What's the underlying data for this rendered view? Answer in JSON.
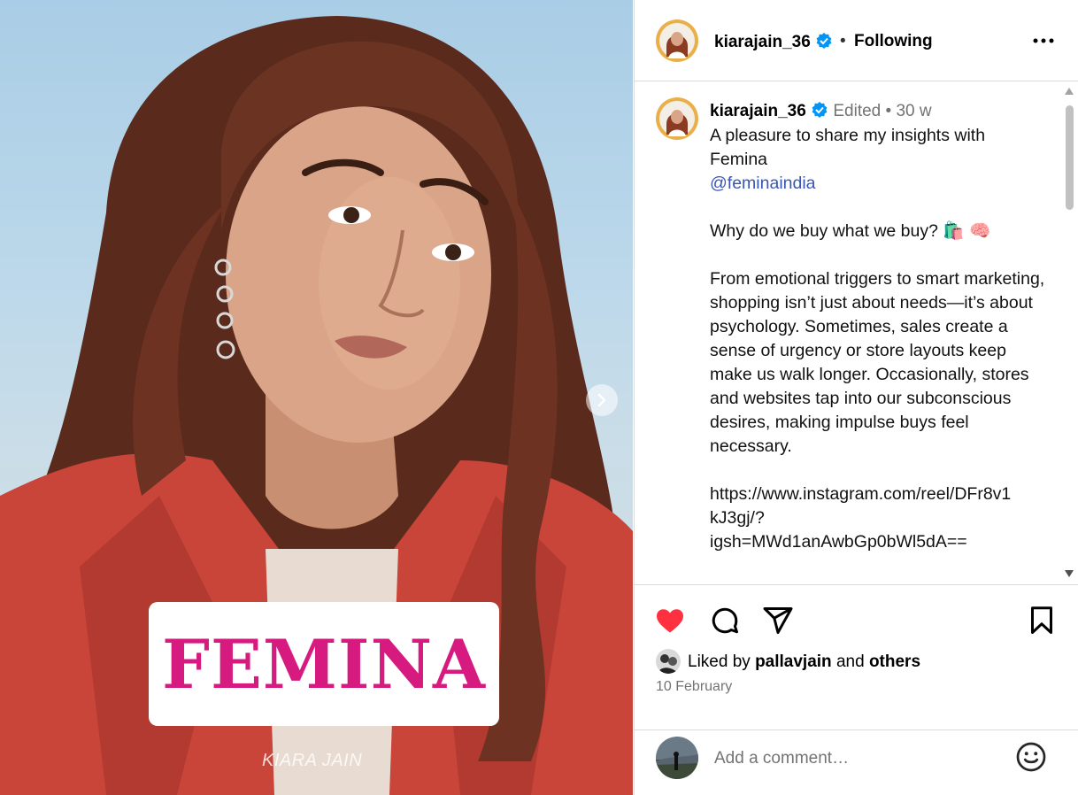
{
  "post_media": {
    "overlay_brand": "FEMINA",
    "watermark": "KIARA JAIN",
    "next_icon": "chevron-right-icon",
    "brand_color": "#d61a7f"
  },
  "header": {
    "username": "kiarajain_36",
    "separator": "•",
    "follow_status": "Following",
    "more_icon": "more-horizontal-icon"
  },
  "caption": {
    "username": "kiarajain_36",
    "edited": "Edited",
    "separator": "•",
    "age": "30 w",
    "line1": "A pleasure to share my insights with Femina",
    "mention": "@feminaindia",
    "question": "Why do we buy what we buy? 🛍️ 🧠",
    "paragraph": "From emotional triggers to smart marketing, shopping isn’t just about needs—it’s about psychology. Sometimes, sales create a sense of urgency or store layouts keep make us walk longer. Occasionally, stores and websites tap into our subconscious desires, making impulse buys feel necessary.",
    "link_line1": "https://www.instagram.com/reel/DFr8v1",
    "link_line2": "kJ3gj/?",
    "link_line3": "igsh=MWd1anAwbGp0bWl5dA=="
  },
  "actions": {
    "like_icon": "heart-filled-icon",
    "comment_icon": "comment-icon",
    "share_icon": "share-icon",
    "save_icon": "bookmark-icon",
    "like_color": "#ff3040"
  },
  "likes": {
    "prefix": "Liked by",
    "user": "pallavjain",
    "conjunction": "and",
    "others": "others"
  },
  "date": "10 February",
  "comment_box": {
    "placeholder": "Add a comment…",
    "emoji_icon": "smiley-icon"
  },
  "colors": {
    "verified": "#0095f6",
    "mention": "#3a56b5",
    "muted": "#737373"
  }
}
